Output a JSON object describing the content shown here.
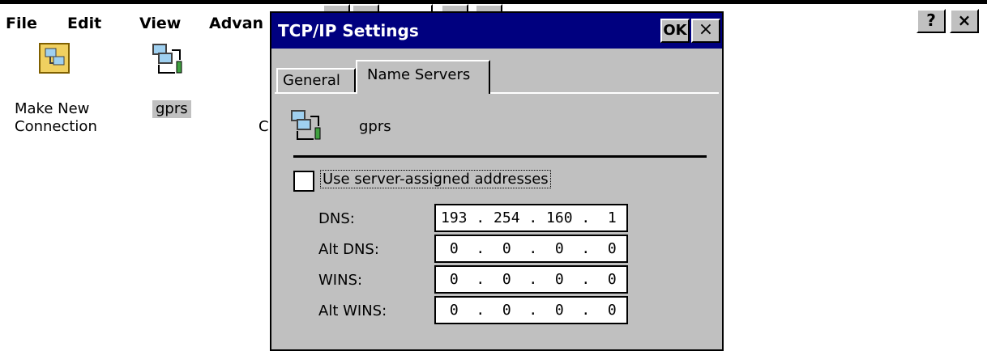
{
  "menu": {
    "file": "File",
    "edit": "Edit",
    "view": "View",
    "advanced": "Advan"
  },
  "caption_buttons": {
    "help": "?",
    "close": "×"
  },
  "desktop_icons": [
    {
      "label_line1": "Make New",
      "label_line2": "Connection",
      "icon": "make-new-connection-icon"
    },
    {
      "label": "gprs",
      "icon": "network-connection-icon"
    }
  ],
  "partial_label": "C",
  "dialog": {
    "title": "TCP/IP Settings",
    "ok_label": "OK",
    "close_label": "×",
    "tabs": [
      {
        "label": "General",
        "active": false
      },
      {
        "label": "Name Servers",
        "active": true
      }
    ],
    "connection_name": "gprs",
    "use_server_assigned": {
      "label": "Use server-assigned addresses",
      "checked": false
    },
    "fields": [
      {
        "label": "DNS:",
        "value": "193 . 254 . 160 .  1"
      },
      {
        "label": "Alt DNS:",
        "value": " 0  .  0  .  0  .  0"
      },
      {
        "label": "WINS:",
        "value": " 0  .  0  .  0  .  0"
      },
      {
        "label": "Alt WINS:",
        "value": " 0  .  0  .  0  .  0"
      }
    ]
  },
  "colors": {
    "titlebar": "#00007f",
    "face": "#c0c0c0",
    "selection": "#c0c0c0"
  }
}
